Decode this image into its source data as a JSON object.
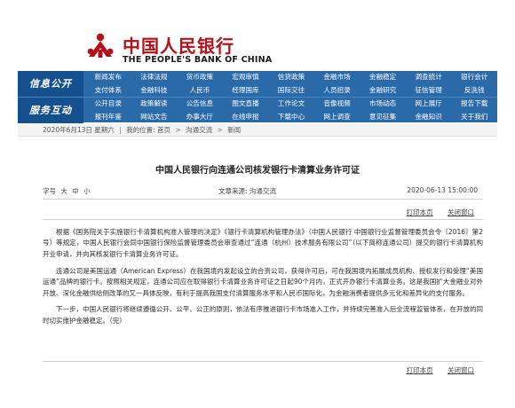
{
  "brand": {
    "name_cn": "中国人民银行",
    "name_en": "THE PEOPLE'S BANK OF CHINA",
    "color": "#b3121a"
  },
  "nav": {
    "bg_color": "#2a6aa8",
    "section1_label": "信息公开",
    "section1_items": [
      "新闻发布",
      "法律法规",
      "货币政策",
      "宏观审慎",
      "信贷政策",
      "金融市场",
      "金融稳定",
      "调查统计",
      "银行会计",
      "支付体系",
      "金融科技",
      "人民币",
      "经理国库",
      "国际交往",
      "人员招录",
      "金融研究",
      "征信管理",
      "反洗钱",
      "党建工作",
      "工会工作"
    ],
    "section2_label": "服务互动",
    "section2_items": [
      "公开目录",
      "政策解读",
      "公告信息",
      "图文直播",
      "工作论文",
      "音像视频",
      "市场动态",
      "网上展厅",
      "报告下载",
      "报刊年鉴",
      "网站文告",
      "办事大厅",
      "在线申报",
      "下载中心",
      "网上调查",
      "意见征集",
      "金融知识",
      "关于我们"
    ]
  },
  "breadcrumb": {
    "date": "2020年6月13日 星期六",
    "prefix": "我的位置:",
    "items": [
      "首页",
      "沟通交流",
      "新闻"
    ]
  },
  "article": {
    "title": "中国人民银行向连通公司核发银行卡清算业务许可证",
    "font_size_label": "字号",
    "sizes": [
      "大",
      "中",
      "小"
    ],
    "source_label": "文章来源:",
    "source": "沟通交流",
    "date": "2020-06-13 15:00:00",
    "print_label": "打印本页",
    "close_label": "关闭窗口",
    "paragraphs": [
      "根据《国务院关于实施银行卡清算机构准入管理的决定》《银行卡清算机构管理办法》（中国人民银行 中国银行业监督管理委员会令〔2016〕第2号）等规定，中国人民银行会同中国银行保险监督管理委员会审查通过“连通（杭州）技术服务有限公司”（以下简称连通公司）提交的银行卡清算机构开业申请，并向其核发银行卡清算业务许可证。",
      "连通公司是美国运通（American Express）在我国境内发起设立的合资公司，获得许可后，可在我国境内拓展成员机构、授权发行和受理“美国运通”品牌的银行卡。按照相关规定，连通公司应在取得银行卡清算业务许可证之日起90个月内，正式开办银行卡清算业务。这是我国扩大金融业对外开放、深化金融供给侧改革的又一具体反映，有利于提高我国支付清算服务水平和人民币国际化，为金融消费者提供多元化和差异化的支付服务。",
      "下一步，中国人民银行将继续遵循公开、公平、公正的原则，依法有序推进银行卡市场准入工作，并持续完善准入后全流程监管体系，在开放的同时切实维护金融稳定。（完）"
    ]
  }
}
